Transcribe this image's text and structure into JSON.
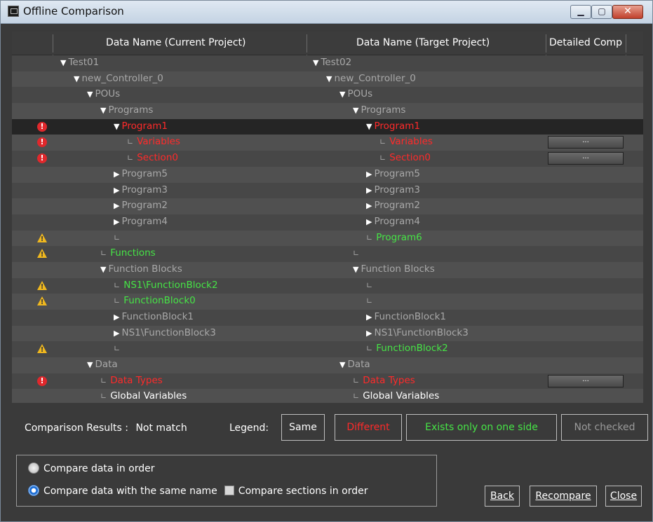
{
  "window": {
    "title": "Offline Comparison",
    "buttons": {
      "minimize": "▁",
      "maximize": "▢",
      "close": "✕"
    }
  },
  "columns": {
    "current": "Data Name (Current Project)",
    "target": "Data Name (Target Project)",
    "detail": "Detailed Comp"
  },
  "rows": [
    {
      "ind": "",
      "left": {
        "t": "Test01",
        "c": "gray",
        "k": "open",
        "l": 1
      },
      "right": {
        "t": "Test02",
        "c": "gray",
        "k": "open",
        "l": 1
      },
      "det": false
    },
    {
      "ind": "",
      "left": {
        "t": "new_Controller_0",
        "c": "gray",
        "k": "open",
        "l": 2
      },
      "right": {
        "t": "new_Controller_0",
        "c": "gray",
        "k": "open",
        "l": 2
      },
      "det": false
    },
    {
      "ind": "",
      "left": {
        "t": "POUs",
        "c": "gray",
        "k": "open",
        "l": 3
      },
      "right": {
        "t": "POUs",
        "c": "gray",
        "k": "open",
        "l": 3
      },
      "det": false
    },
    {
      "ind": "",
      "left": {
        "t": "Programs",
        "c": "gray",
        "k": "open",
        "l": 4
      },
      "right": {
        "t": "Programs",
        "c": "gray",
        "k": "open",
        "l": 4
      },
      "det": false
    },
    {
      "ind": "err",
      "sel": true,
      "left": {
        "t": "Program1",
        "c": "red",
        "k": "open",
        "l": 5
      },
      "right": {
        "t": "Program1",
        "c": "red",
        "k": "open",
        "l": 5
      },
      "det": false
    },
    {
      "ind": "err",
      "left": {
        "t": "Variables",
        "c": "red",
        "k": "leaf",
        "l": 6
      },
      "right": {
        "t": "Variables",
        "c": "red",
        "k": "leaf",
        "l": 6
      },
      "det": true
    },
    {
      "ind": "err",
      "left": {
        "t": "Section0",
        "c": "red",
        "k": "leaf",
        "l": 6
      },
      "right": {
        "t": "Section0",
        "c": "red",
        "k": "leaf",
        "l": 6
      },
      "det": true
    },
    {
      "ind": "",
      "left": {
        "t": "Program5",
        "c": "gray",
        "k": "closed",
        "l": 5
      },
      "right": {
        "t": "Program5",
        "c": "gray",
        "k": "closed",
        "l": 5
      },
      "det": false
    },
    {
      "ind": "",
      "left": {
        "t": "Program3",
        "c": "gray",
        "k": "closed",
        "l": 5
      },
      "right": {
        "t": "Program3",
        "c": "gray",
        "k": "closed",
        "l": 5
      },
      "det": false
    },
    {
      "ind": "",
      "left": {
        "t": "Program2",
        "c": "gray",
        "k": "closed",
        "l": 5
      },
      "right": {
        "t": "Program2",
        "c": "gray",
        "k": "closed",
        "l": 5
      },
      "det": false
    },
    {
      "ind": "",
      "left": {
        "t": "Program4",
        "c": "gray",
        "k": "closed",
        "l": 5
      },
      "right": {
        "t": "Program4",
        "c": "gray",
        "k": "closed",
        "l": 5
      },
      "det": false
    },
    {
      "ind": "warn",
      "left": {
        "t": "",
        "c": "gray",
        "k": "leaf",
        "l": 5
      },
      "right": {
        "t": "Program6",
        "c": "green",
        "k": "leaf",
        "l": 5
      },
      "det": false
    },
    {
      "ind": "warn",
      "left": {
        "t": "Functions",
        "c": "green",
        "k": "leaf",
        "l": 4
      },
      "right": {
        "t": "",
        "c": "gray",
        "k": "leaf",
        "l": 4
      },
      "det": false
    },
    {
      "ind": "",
      "left": {
        "t": "Function Blocks",
        "c": "gray",
        "k": "open",
        "l": 4
      },
      "right": {
        "t": "Function Blocks",
        "c": "gray",
        "k": "open",
        "l": 4
      },
      "det": false
    },
    {
      "ind": "warn",
      "left": {
        "t": "NS1\\FunctionBlock2",
        "c": "green",
        "k": "leaf",
        "l": 5
      },
      "right": {
        "t": "",
        "c": "gray",
        "k": "leaf",
        "l": 5
      },
      "det": false
    },
    {
      "ind": "warn",
      "left": {
        "t": "FunctionBlock0",
        "c": "green",
        "k": "leaf",
        "l": 5
      },
      "right": {
        "t": "",
        "c": "gray",
        "k": "leaf",
        "l": 5
      },
      "det": false
    },
    {
      "ind": "",
      "left": {
        "t": "FunctionBlock1",
        "c": "gray",
        "k": "closed",
        "l": 5
      },
      "right": {
        "t": "FunctionBlock1",
        "c": "gray",
        "k": "closed",
        "l": 5
      },
      "det": false
    },
    {
      "ind": "",
      "left": {
        "t": "NS1\\FunctionBlock3",
        "c": "gray",
        "k": "closed",
        "l": 5
      },
      "right": {
        "t": "NS1\\FunctionBlock3",
        "c": "gray",
        "k": "closed",
        "l": 5
      },
      "det": false
    },
    {
      "ind": "warn",
      "left": {
        "t": "",
        "c": "gray",
        "k": "leaf",
        "l": 5
      },
      "right": {
        "t": "FunctionBlock2",
        "c": "green",
        "k": "leaf",
        "l": 5
      },
      "det": false
    },
    {
      "ind": "",
      "left": {
        "t": "Data",
        "c": "gray",
        "k": "open",
        "l": 3
      },
      "right": {
        "t": "Data",
        "c": "gray",
        "k": "open",
        "l": 3
      },
      "det": false
    },
    {
      "ind": "err",
      "left": {
        "t": "Data Types",
        "c": "red",
        "k": "leaf",
        "l": 4
      },
      "right": {
        "t": "Data Types",
        "c": "red",
        "k": "leaf",
        "l": 4
      },
      "det": true
    },
    {
      "ind": "",
      "left": {
        "t": "Global Variables",
        "c": "white",
        "k": "leaf",
        "l": 4
      },
      "right": {
        "t": "Global Variables",
        "c": "white",
        "k": "leaf",
        "l": 4
      },
      "det": false
    }
  ],
  "detail_button_label": "...",
  "indicator_glyphs": {
    "err": "!",
    "warn": "!"
  },
  "tree_glyphs": {
    "open": "▼",
    "closed": "▶",
    "leaf": "∟"
  },
  "results": {
    "label": "Comparison Results :",
    "value": "Not match"
  },
  "legend": {
    "label": "Legend:",
    "same": "Same",
    "different": "Different",
    "one_side": "Exists only on one side",
    "not_checked": "Not checked"
  },
  "options": {
    "compare_in_order": "Compare data in order",
    "compare_same_name": "Compare data with the same name",
    "compare_sections": "Compare sections in order",
    "selected": "compare_same_name",
    "sections_checked": false
  },
  "buttons": {
    "back": "Back",
    "recompare": "Recompare",
    "close": "Close"
  },
  "colors": {
    "different": "#ff2a2a",
    "one_side": "#46e446",
    "same": "#ffffff",
    "not_checked": "#9a9a9a"
  }
}
